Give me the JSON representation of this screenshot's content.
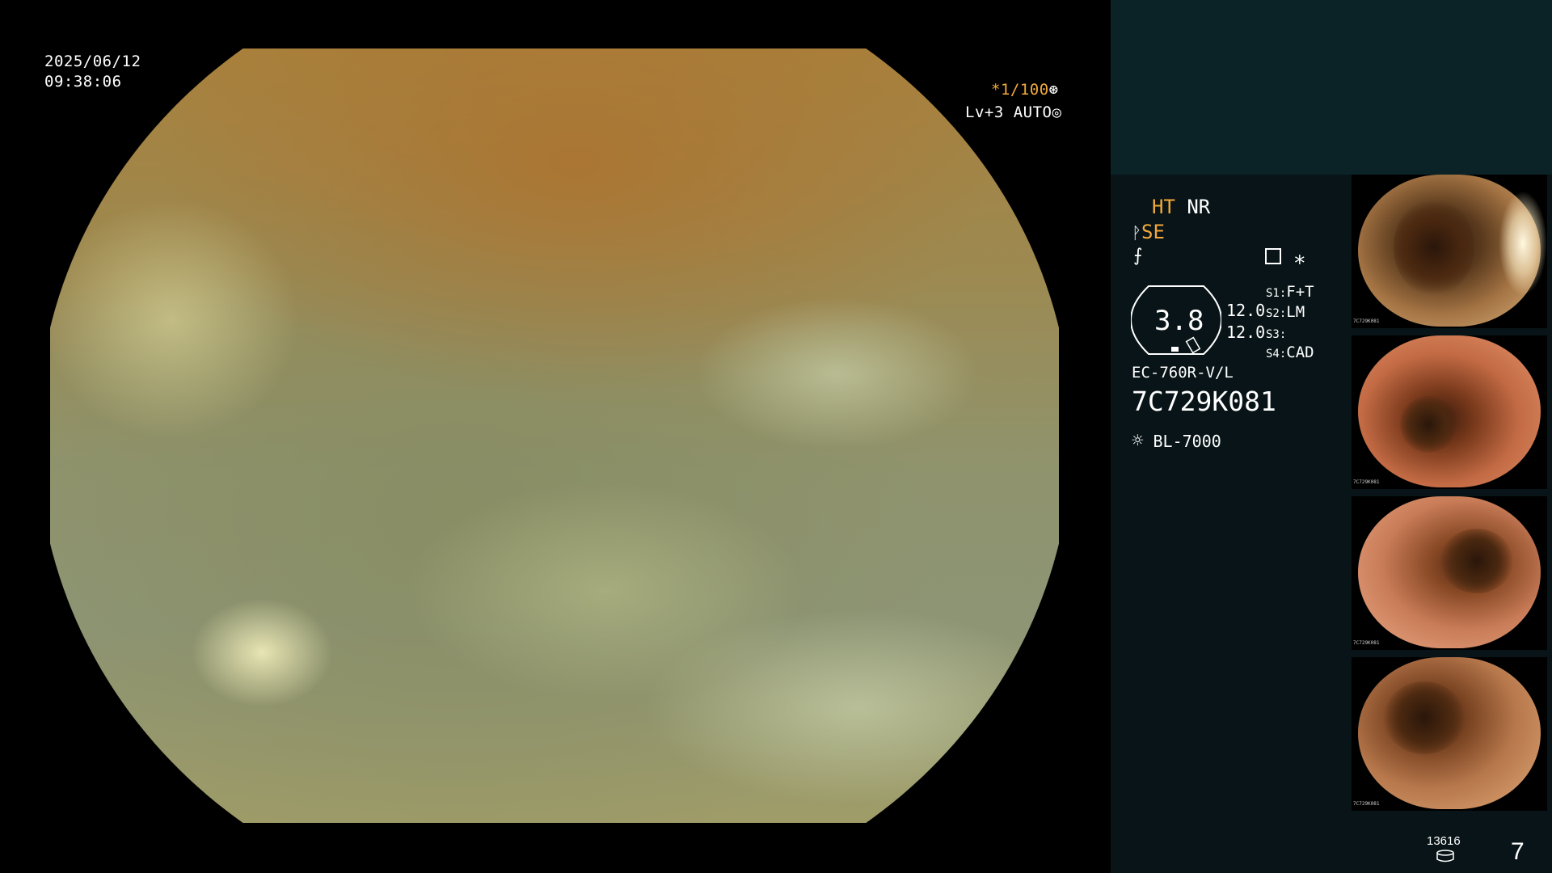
{
  "osd": {
    "date": "2025/06/12",
    "time": "09:38:06",
    "shutter": "*1/100",
    "level": "Lv+3",
    "mode": "AUTO"
  },
  "panel": {
    "ht": "HT",
    "nr": "NR",
    "se": "SE",
    "gauge_value": "3.8",
    "stat_1": "12.0",
    "stat_2": "12.0",
    "s1_key": "S1:",
    "s1_val": "F+T",
    "s2_key": "S2:",
    "s2_val": "LM",
    "s3_key": "S3:",
    "s3_val": "",
    "s4_key": "S4:",
    "s4_val": "CAD",
    "scope_model": "EC-760R-V/L",
    "serial": "7C729K081",
    "light_source": "BL-7000",
    "storage_count": "13616",
    "image_count": "7"
  },
  "thumbnails": [
    {
      "label": "7C729K081",
      "tone": "#8a5a2c"
    },
    {
      "label": "7C729K081",
      "tone": "#c06a45"
    },
    {
      "label": "7C729K081",
      "tone": "#c67d5b"
    },
    {
      "label": "7C729K081",
      "tone": "#b67a4e"
    }
  ],
  "colors": {
    "accent_amber": "#f2a93b",
    "panel_bg": "#081417",
    "panel_top_bg": "#0b2326"
  }
}
